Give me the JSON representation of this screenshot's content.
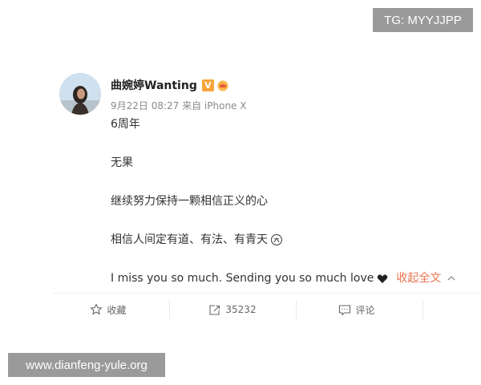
{
  "watermarks": {
    "top": "TG: MYYJJPP",
    "bottom": "www.dianfeng-yule.org"
  },
  "post": {
    "username": "曲婉婷Wanting",
    "verified_badge": "V",
    "meta": "9月22日 08:27 来自 iPhone X",
    "lines": {
      "l1": "6周年",
      "l2": "无果",
      "l3": "继续努力保持一颗相信正义的心",
      "l4": "相信人间定有道、有法、有青天",
      "l5": "I miss you so much. Sending you so much love"
    },
    "collapse_label": "收起全文"
  },
  "actions": {
    "favorite": "收藏",
    "repost_count": "35232",
    "comment": "评论"
  },
  "colors": {
    "accent": "#eb7350",
    "badge": "#f7a43b",
    "meta": "#8a8a8a"
  },
  "icons": [
    "star-icon",
    "repost-icon",
    "comment-icon",
    "crown-icon",
    "heart-icon",
    "pray-emoji-icon",
    "chevron-up-icon"
  ]
}
